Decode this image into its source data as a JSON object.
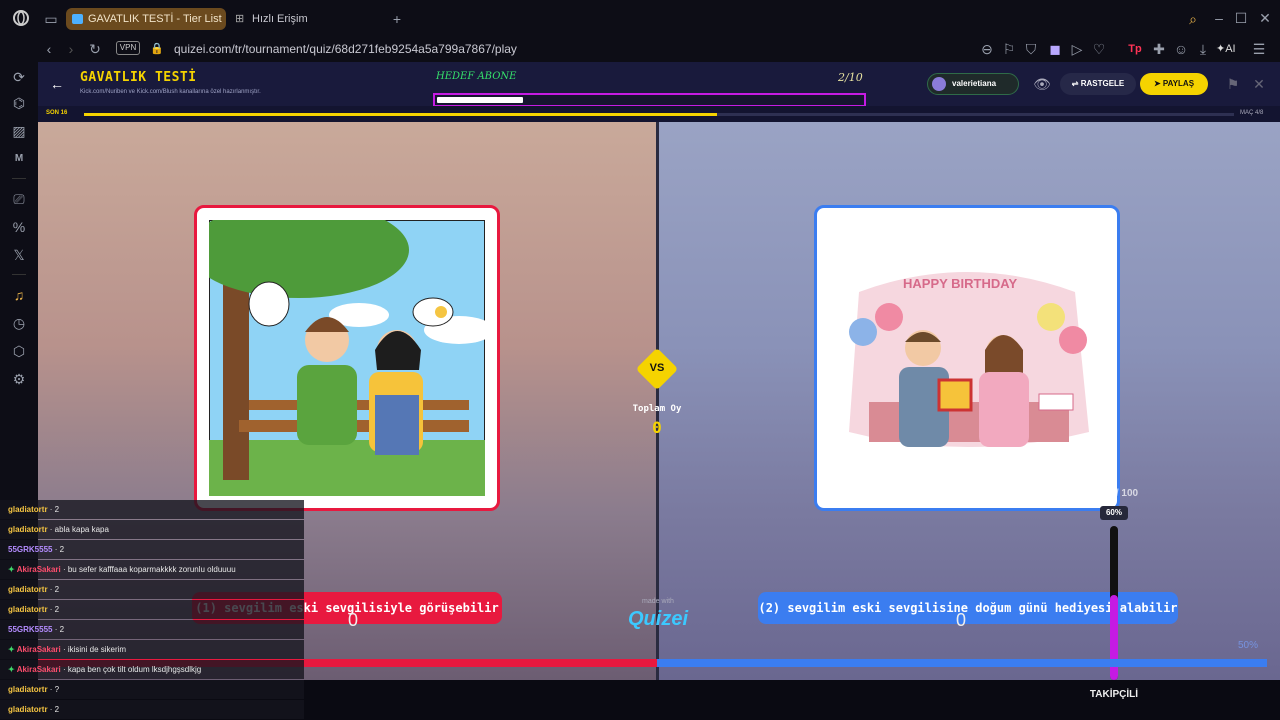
{
  "browser": {
    "tabs": [
      {
        "label": "GAVATLIK TESTİ - Tier List",
        "active": true
      },
      {
        "label": "Hızlı Erişim",
        "active": false
      }
    ],
    "vpn_label": "VPN",
    "url": "quizei.com/tr/tournament/quiz/68d271feb9254a5a799a7867/play",
    "ai_label": "AI"
  },
  "quiz": {
    "title": "GAVATLIK TESTİ",
    "subtitle": "Kick.com/Nuriben ve Kick.com/Blush kanallarına özel hazırlanmıştır.",
    "goal_label": "HEDEF ABONE",
    "goal_count": "2/10",
    "goal_progress": 0.2,
    "user": "valerietiana",
    "random_label": "RASTGELE",
    "share_label": "PAYLAŞ",
    "round_label": "SON 16",
    "round_progress": 0.55,
    "match_label": "MAÇ 4/8",
    "vs_label": "VS",
    "total_votes_label": "Toplam Oy",
    "total_votes": "0",
    "left_option": "(1) sevgilim eski sevgilisiyle görüşebilir",
    "right_option": "(2) sevgilim eski sevgilisine doğum günü hediyesi alabilir",
    "left_votes": "0",
    "right_votes": "0",
    "made_with": "made with",
    "brand": "Quizei",
    "follower_count": "60 / 100",
    "follower_percent": "60%",
    "right_pct": "50%",
    "follower_label": "TAKİPÇİLİ",
    "birthday_banner": "HAPPY BIRTHDAY",
    "colors": {
      "left": "#e8193f",
      "right": "#3b7df0",
      "accent": "#f5d300",
      "purple": "#c51be3"
    }
  },
  "chat": [
    {
      "user": "gladiatortr",
      "msg": "2",
      "badge": false,
      "color": "#f5c542"
    },
    {
      "user": "gladiatortr",
      "msg": "abla kapa kapa",
      "badge": false,
      "color": "#f5c542"
    },
    {
      "user": "55GRK5555",
      "msg": "2",
      "badge": false,
      "color": "#b48cff"
    },
    {
      "user": "AkiraSakari",
      "msg": "bu sefer kafffaaa koparmakkkk zorunlu olduuuu",
      "badge": true,
      "color": "#ff4d6d"
    },
    {
      "user": "gladiatortr",
      "msg": "2",
      "badge": false,
      "color": "#f5c542"
    },
    {
      "user": "gladiatortr",
      "msg": "2",
      "badge": false,
      "color": "#f5c542"
    },
    {
      "user": "55GRK5555",
      "msg": "2",
      "badge": false,
      "color": "#b48cff"
    },
    {
      "user": "AkiraSakari",
      "msg": "ikisini de sikerim",
      "badge": true,
      "color": "#ff4d6d"
    },
    {
      "user": "AkiraSakari",
      "msg": "kapa ben çok tilt oldum lksdjhgşsdlkjg",
      "badge": true,
      "color": "#ff4d6d"
    },
    {
      "user": "gladiatortr",
      "msg": "?",
      "badge": false,
      "color": "#f5c542"
    },
    {
      "user": "gladiatortr",
      "msg": "2",
      "badge": false,
      "color": "#f5c542"
    }
  ]
}
